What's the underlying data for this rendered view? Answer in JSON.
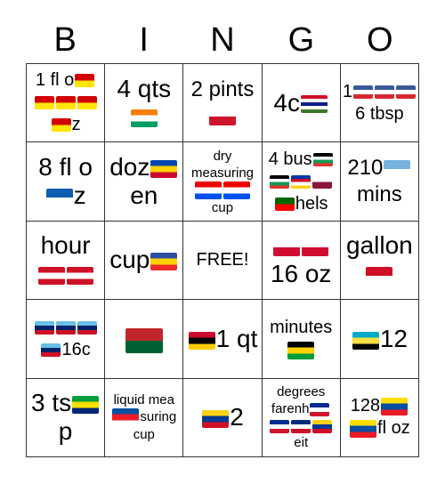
{
  "header": {
    "letters": [
      "B",
      "I",
      "N",
      "G",
      "O"
    ]
  },
  "cells": [
    {
      "id": "r1c1",
      "parts": [
        "1 fl o",
        "flag:north-macedonia",
        "flag:north-macedonia",
        "flag:north-macedonia",
        "flag:north-macedonia",
        "flag:north-macedonia",
        "z"
      ],
      "size": "m"
    },
    {
      "id": "r1c2",
      "parts": [
        "4 qts",
        "flag:cote-divoire"
      ],
      "size": "xl"
    },
    {
      "id": "r1c3",
      "parts": [
        "2 pints",
        "flag:malta"
      ],
      "size": "l"
    },
    {
      "id": "r1c4",
      "parts": [
        "4c",
        "flag:gambia"
      ],
      "size": "xl"
    },
    {
      "id": "r1c5",
      "parts": [
        "1",
        "flag:saint-pierre-miquelon",
        "flag:saint-pierre-miquelon",
        "flag:saint-pierre-miquelon",
        "6 tbsp"
      ],
      "size": "m"
    },
    {
      "id": "r2c1",
      "parts": [
        "8 fl o",
        "flag:greece",
        "z"
      ],
      "size": "xl"
    },
    {
      "id": "r2c2",
      "parts": [
        "doz",
        "flag:moldova",
        "en"
      ],
      "size": "xl"
    },
    {
      "id": "r2c3",
      "parts": [
        "dry measuring",
        "flag:puerto-rico",
        "flag:puerto-rico",
        "cup"
      ],
      "size": "s"
    },
    {
      "id": "r2c4",
      "parts": [
        "4 bus",
        "flag:palestine",
        "flag:palestine",
        "flag:philippines",
        "flag:qatar",
        "flag:portugal",
        "hels"
      ],
      "size": "m"
    },
    {
      "id": "r2c5",
      "parts": [
        "210",
        "flag:micronesia",
        "mins"
      ],
      "size": "l"
    },
    {
      "id": "r3c1",
      "parts": [
        "hour",
        "flag:french-polynesia",
        "flag:french-polynesia"
      ],
      "size": "xl"
    },
    {
      "id": "r3c2",
      "parts": [
        "cup",
        "flag:reunion"
      ],
      "size": "xl"
    },
    {
      "id": "r3c3",
      "parts": [
        "FREE!"
      ],
      "size": "m",
      "free": true
    },
    {
      "id": "r3c4",
      "parts": [
        "flag:greenland",
        "flag:greenland",
        "16 oz"
      ],
      "size": "xl"
    },
    {
      "id": "r3c5",
      "parts": [
        "gallon",
        "flag:monaco"
      ],
      "size": "xl"
    },
    {
      "id": "r4c1",
      "parts": [
        "flag:fiji",
        "flag:fiji",
        "flag:fiji",
        "flag:fiji",
        "16c"
      ],
      "size": "m"
    },
    {
      "id": "r4c2",
      "parts": [
        "flag:morocco"
      ],
      "size": "xl"
    },
    {
      "id": "r4c3",
      "parts": [
        "flag:angola",
        "1 qt"
      ],
      "size": "xl"
    },
    {
      "id": "r4c4",
      "parts": [
        "minutes",
        "flag:jamaica"
      ],
      "size": "m"
    },
    {
      "id": "r4c5",
      "parts": [
        "flag:bahamas",
        "12"
      ],
      "size": "xl"
    },
    {
      "id": "r5c1",
      "parts": [
        "3 ts",
        "flag:brazil",
        "p"
      ],
      "size": "xl"
    },
    {
      "id": "r5c2",
      "parts": [
        "liquid mea",
        "flag:north-korea",
        "suring cup"
      ],
      "size": "s"
    },
    {
      "id": "r5c3",
      "parts": [
        "flag:colombia",
        "2"
      ],
      "size": "xl"
    },
    {
      "id": "r5c4",
      "parts": [
        "degrees farenh",
        "flag:cuba",
        "flag:cuba",
        "flag:costa-rica",
        "flag:colombia",
        "eit"
      ],
      "size": "s"
    },
    {
      "id": "r5c5",
      "parts": [
        "128",
        "flag:ecuador",
        "flag:ecuador",
        "fl oz"
      ],
      "size": "m"
    }
  ],
  "flag_colors": {
    "north-macedonia": [
      "#d20000",
      "#ffe600"
    ],
    "cote-divoire": [
      "#f77f00",
      "#ffffff",
      "#009e60"
    ],
    "malta": [
      "#ffffff",
      "#cf142b"
    ],
    "gambia": [
      "#ce1126",
      "#ffffff",
      "#0c1c8c",
      "#ffffff",
      "#3a7728"
    ],
    "saint-pierre-miquelon": [
      "#3b5998",
      "#ffffff",
      "#d8282f"
    ],
    "greece": [
      "#0d5eaf",
      "#ffffff"
    ],
    "moldova": [
      "#0046ae",
      "#ffd200",
      "#cc092f"
    ],
    "puerto-rico": [
      "#ed0000",
      "#ffffff",
      "#0050f0"
    ],
    "palestine": [
      "#000000",
      "#ffffff",
      "#149954",
      "#e4312b"
    ],
    "philippines": [
      "#0038a8",
      "#ce1126",
      "#ffffff",
      "#fcd116"
    ],
    "qatar": [
      "#ffffff",
      "#8a1538"
    ],
    "portugal": [
      "#006600",
      "#ff0000"
    ],
    "micronesia": [
      "#75b2dd",
      "#ffffff"
    ],
    "french-polynesia": [
      "#ce1126",
      "#ffffff",
      "#ce1126"
    ],
    "reunion": [
      "#2d4ea3",
      "#ffd200",
      "#ef2c2c"
    ],
    "greenland": [
      "#ffffff",
      "#d00c33"
    ],
    "monaco": [
      "#ce1126",
      "#ffffff"
    ],
    "fiji": [
      "#68bfe5",
      "#012169",
      "#ce1126"
    ],
    "morocco": [
      "#c1272d",
      "#006233"
    ],
    "angola": [
      "#cc092f",
      "#000000",
      "#ffcb00"
    ],
    "jamaica": [
      "#000000",
      "#fed100",
      "#009b3a"
    ],
    "bahamas": [
      "#00abc9",
      "#fae042",
      "#000000"
    ],
    "brazil": [
      "#009c3b",
      "#ffdf00",
      "#002776"
    ],
    "north-korea": [
      "#024fa2",
      "#ed1c27",
      "#ffffff"
    ],
    "colombia": [
      "#fcd116",
      "#003893",
      "#ce1126"
    ],
    "cuba": [
      "#002a8f",
      "#ffffff",
      "#cf142b"
    ],
    "costa-rica": [
      "#002b7f",
      "#ffffff",
      "#ce1126"
    ],
    "ecuador": [
      "#ffdd00",
      "#034ea2",
      "#ed1c24"
    ]
  }
}
